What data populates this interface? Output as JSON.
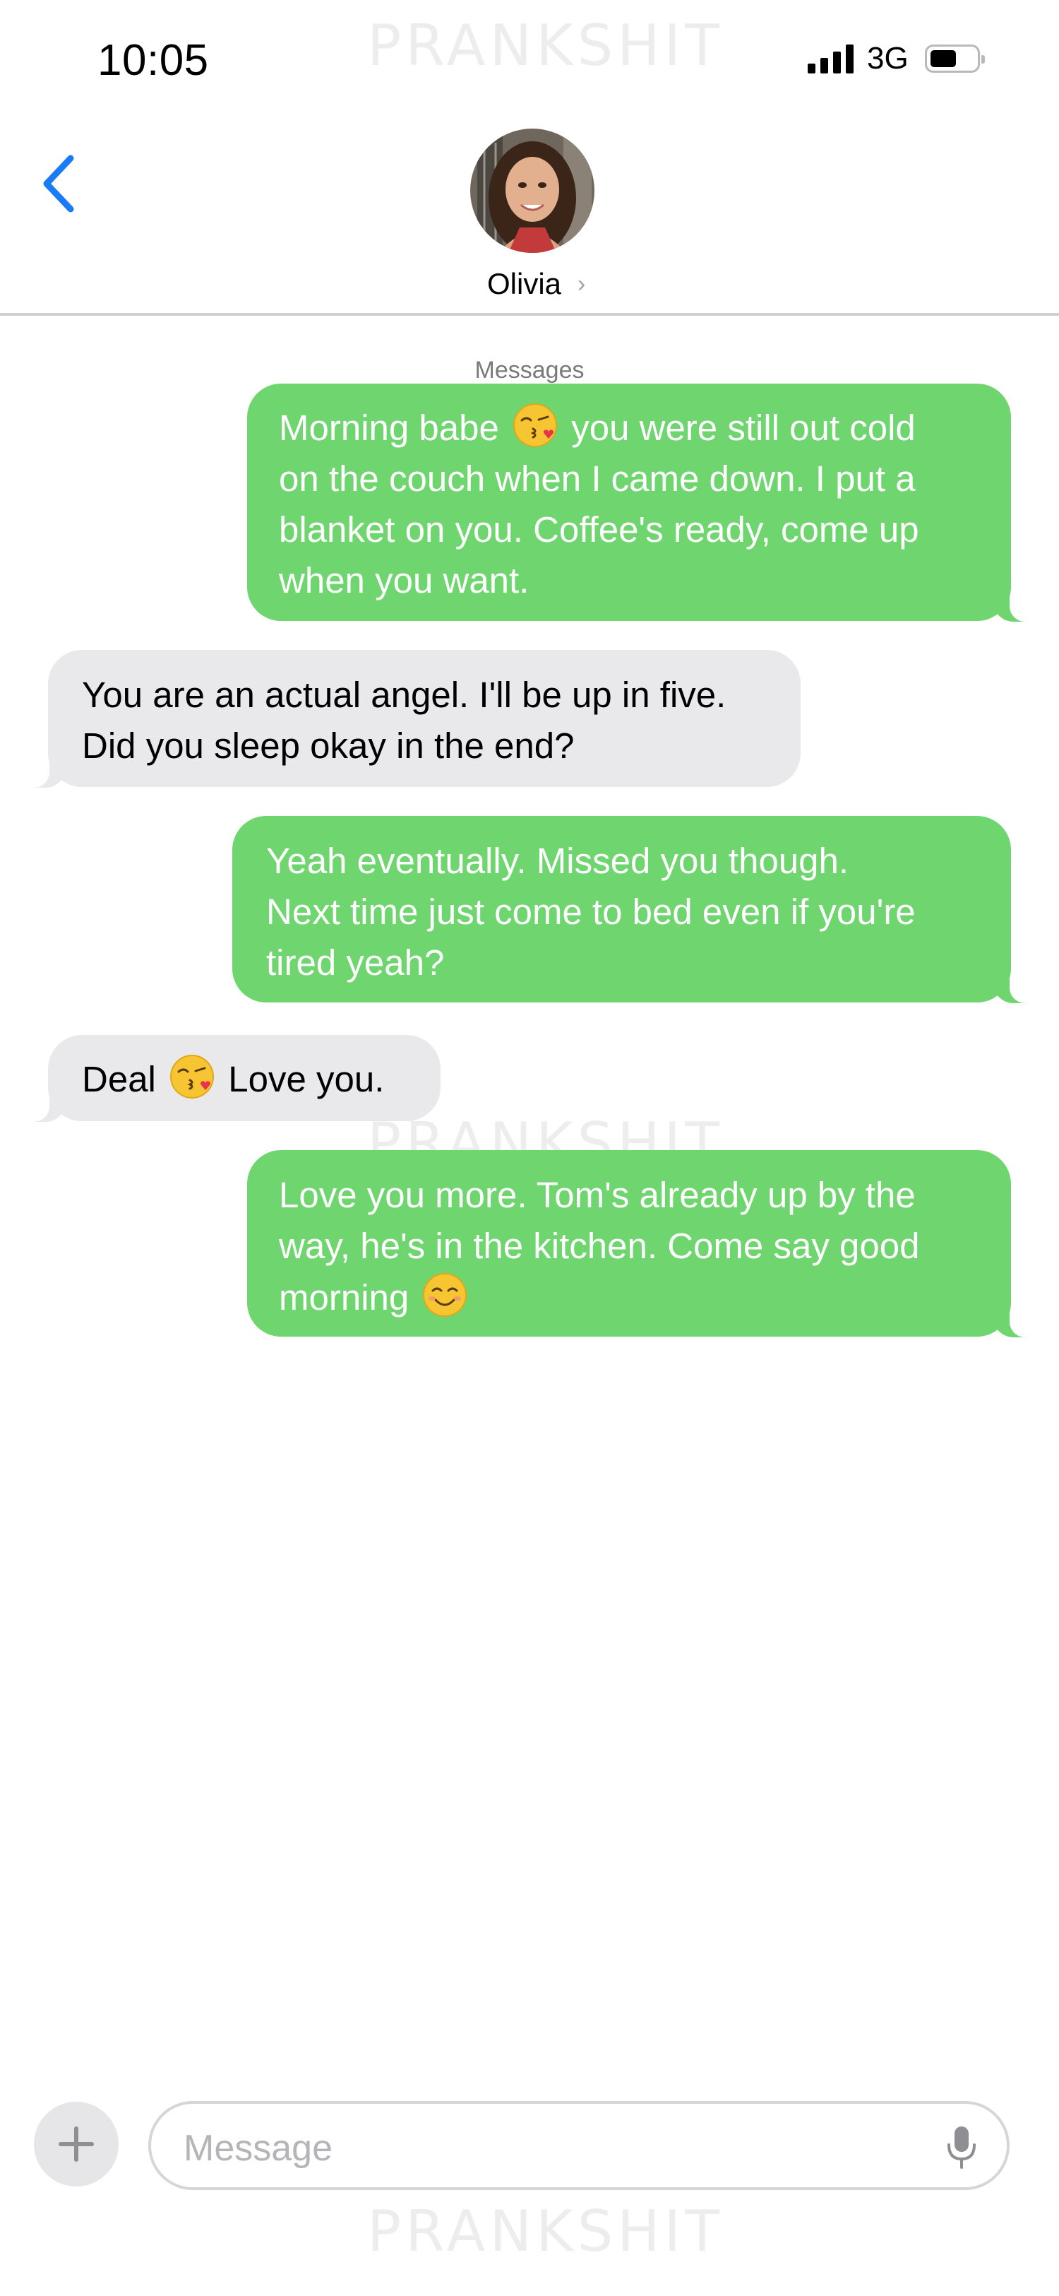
{
  "status_bar": {
    "time": "10:05",
    "network": "3G",
    "signal_bars": 4,
    "battery_level": 0.5
  },
  "watermark": "PRANKSHIT",
  "header": {
    "contact_name": "Olivia",
    "chevron": "›",
    "back_icon": "chevron-left-icon"
  },
  "conversation": {
    "service_label": "Messages",
    "messages": [
      {
        "direction": "sent",
        "lines": [
          "Morning babe [kiss] you were still out cold",
          "on the couch when I came down. I put a",
          "blanket on you. Coffee's ready, come up",
          "when you want."
        ]
      },
      {
        "direction": "received",
        "lines": [
          "You are an actual angel. I'll be up in five.",
          "Did you sleep okay in the end?"
        ]
      },
      {
        "direction": "sent",
        "lines": [
          "Yeah eventually. Missed you though.",
          "Next time just come to bed even if you're",
          "tired yeah?"
        ]
      },
      {
        "direction": "received",
        "lines": [
          "Deal [kiss] Love you."
        ]
      },
      {
        "direction": "sent",
        "lines": [
          "Love you more. Tom's already up by the",
          "way, he's in the kitchen. Come say good",
          "morning [smile]"
        ]
      }
    ]
  },
  "composer": {
    "placeholder": "Message",
    "plus_icon": "plus-icon",
    "mic_icon": "microphone-icon"
  },
  "colors": {
    "sent_bubble": "#6fd66f",
    "received_bubble": "#e9e9eb",
    "accent": "#1a7cf5"
  }
}
